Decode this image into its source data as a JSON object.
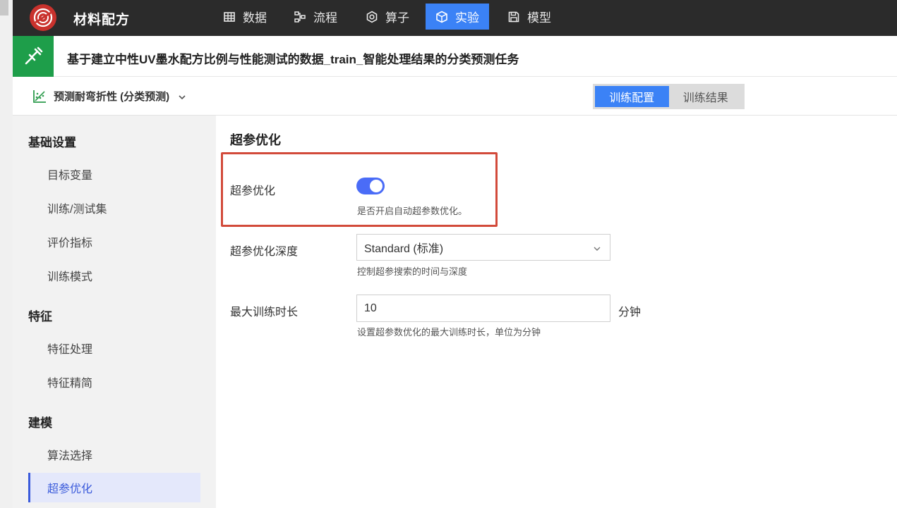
{
  "app": {
    "title": "材料配方"
  },
  "nav": {
    "items": [
      {
        "label": "数据",
        "icon": "table-icon"
      },
      {
        "label": "流程",
        "icon": "flow-icon"
      },
      {
        "label": "算子",
        "icon": "operator-icon"
      },
      {
        "label": "实验",
        "icon": "cube-icon",
        "active": true
      },
      {
        "label": "模型",
        "icon": "save-icon"
      }
    ]
  },
  "header": {
    "title": "基于建立中性UV墨水配方比例与性能测试的数据_train_智能处理结果的分类预测任务"
  },
  "task": {
    "label": "预测耐弯折性 (分类预测)"
  },
  "tabs": [
    {
      "label": "训练配置",
      "active": true
    },
    {
      "label": "训练结果"
    }
  ],
  "sidebar": {
    "sections": [
      {
        "title": "基础设置",
        "items": [
          "目标变量",
          "训练/测试集",
          "评价指标",
          "训练模式"
        ]
      },
      {
        "title": "特征",
        "items": [
          "特征处理",
          "特征精简"
        ]
      },
      {
        "title": "建模",
        "items": [
          "算法选择",
          "超参优化"
        ]
      }
    ],
    "active_item": "超参优化"
  },
  "main": {
    "title": "超参优化",
    "hpo": {
      "label": "超参优化",
      "enabled": true,
      "hint": "是否开启自动超参数优化。"
    },
    "depth": {
      "label": "超参优化深度",
      "value": "Standard (标准)",
      "hint": "控制超参搜索的时间与深度"
    },
    "max_time": {
      "label": "最大训练时长",
      "value": "10",
      "unit": "分钟",
      "hint": "设置超参数优化的最大训练时长，单位为分钟"
    }
  },
  "colors": {
    "accent": "#3b82f6",
    "toggle_on": "#4a6cf7",
    "topbar": "#2b2b2b",
    "header_badge": "#1e9e4a",
    "highlight_border": "#d24a3a",
    "logo": "#c9322d"
  }
}
